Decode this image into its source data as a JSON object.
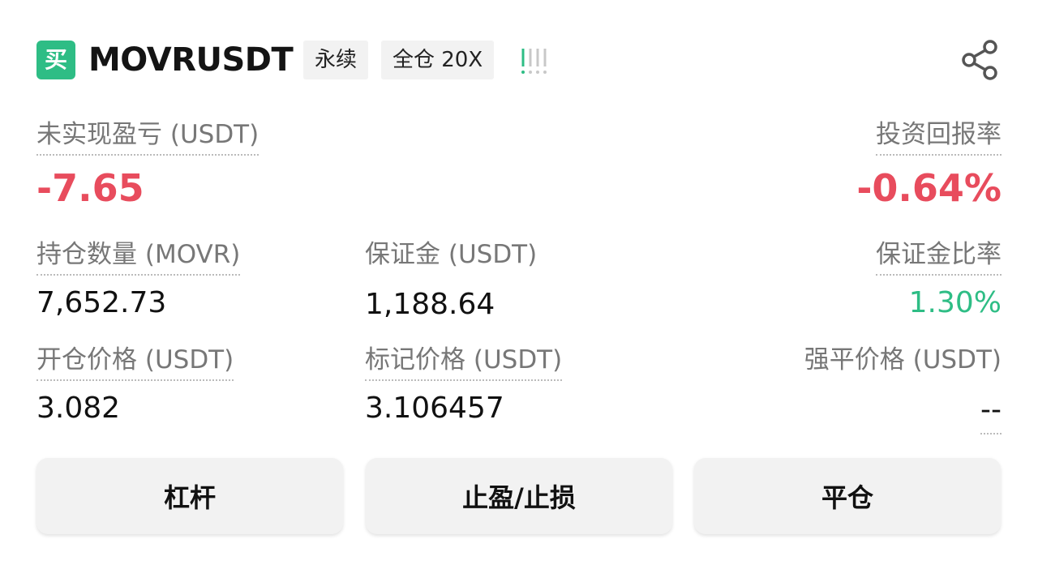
{
  "header": {
    "side_badge": "买",
    "symbol": "MOVRUSDT",
    "contract_type": "永续",
    "margin_mode": "全仓 20X"
  },
  "icons": {
    "signal": "signal-bars-icon",
    "share": "share-icon"
  },
  "pnl": {
    "unrealized_label": "未实现盈亏 (USDT)",
    "unrealized_value": "-7.65",
    "roi_label": "投资回报率",
    "roi_value": "-0.64%"
  },
  "stats": {
    "size_label": "持仓数量 (MOVR)",
    "size_value": "7,652.73",
    "margin_label": "保证金 (USDT)",
    "margin_value": "1,188.64",
    "margin_ratio_label": "保证金比率",
    "margin_ratio_value": "1.30%",
    "entry_label": "开仓价格 (USDT)",
    "entry_value": "3.082",
    "mark_label": "标记价格 (USDT)",
    "mark_value": "3.106457",
    "liq_label": "强平价格 (USDT)",
    "liq_value": "--"
  },
  "actions": {
    "leverage": "杠杆",
    "tpsl": "止盈/止损",
    "close": "平仓"
  },
  "colors": {
    "buy": "#2ebd85",
    "negative": "#e84c5d",
    "positive": "#2ebd85"
  }
}
